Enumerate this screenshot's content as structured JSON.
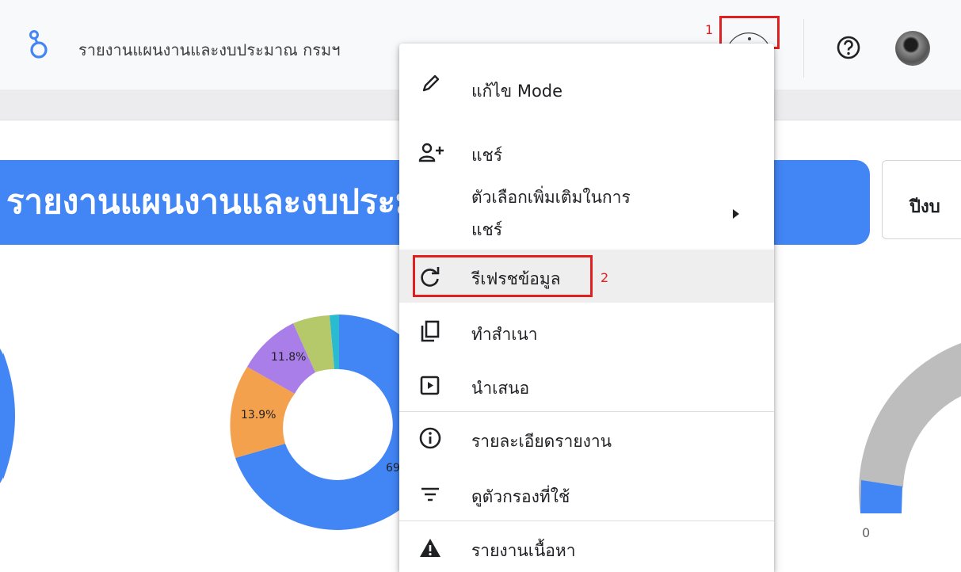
{
  "header": {
    "report_title": "รายงานแผนงานและงบประมาณ กรมฯ",
    "annotation_1": "1"
  },
  "canvas": {
    "banner_title": "รายงานแผนงานและงบประมาณ",
    "year_filter_label": "ปีงบ",
    "donut_labels": [
      "11.8%",
      "13.9%",
      "69"
    ],
    "gauge_min_label": "0"
  },
  "menu": {
    "items": [
      {
        "icon": "pencil-icon",
        "label": "แก้ไข Mode"
      },
      {
        "icon": "share-person-icon",
        "label": "แชร์"
      },
      {
        "icon": "chevron-right-icon",
        "label_line1": "ตัวเลือกเพิ่มเติมในการ",
        "label_line2": "แชร์"
      },
      {
        "icon": "refresh-icon",
        "label": "รีเฟรชข้อมูล"
      },
      {
        "icon": "copy-icon",
        "label": "ทำสำเนา"
      },
      {
        "icon": "present-icon",
        "label": "นำเสนอ"
      },
      {
        "icon": "info-icon",
        "label": "รายละเอียดรายงาน"
      },
      {
        "icon": "filter-icon",
        "label": "ดูตัวกรองที่ใช้"
      },
      {
        "icon": "warning-icon",
        "label": "รายงานเนื้อหา"
      }
    ],
    "annotation_2": "2"
  },
  "colors": {
    "accent_blue": "#4285f4",
    "orange": "#f4a14d",
    "purple": "#a97ee8",
    "olive": "#b5c86a",
    "teal": "#2bbbd1",
    "gauge_gray": "#bdbdbd",
    "annotation_red": "#e02020"
  }
}
